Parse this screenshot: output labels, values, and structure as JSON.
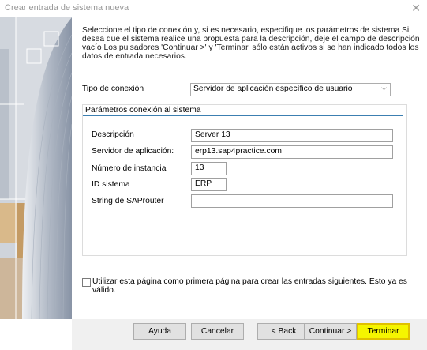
{
  "window": {
    "title": "Crear entrada de sistema nueva"
  },
  "intro": "Seleccione el tipo de conexión y, si es necesario, especifique los parámetros de sistema Si desea que el sistema realice una propuesta para la descripción, deje el campo de descripción vacío Los pulsadores 'Continuar >' y 'Terminar' sólo están activos si se han indicado todos los datos de entrada necesarios.",
  "connection": {
    "label": "Tipo de conexión",
    "value": "Servidor de aplicación específico de usuario"
  },
  "params": {
    "title": "Parámetros conexión al sistema",
    "description": {
      "label": "Descripción",
      "value": "Server 13"
    },
    "app_server": {
      "label": "Servidor de aplicación:",
      "value": "erp13.sap4practice.com"
    },
    "instance": {
      "label": "Número de instancia",
      "value": "13"
    },
    "system_id": {
      "label": "ID sistema",
      "value": "ERP"
    },
    "saprouter": {
      "label": "String de SAProuter",
      "value": ""
    }
  },
  "first_page": {
    "label": "Utilizar esta página como primera página para crear las entradas siguientes. Esto ya es válido.",
    "checked": false
  },
  "buttons": {
    "help": "Ayuda",
    "cancel": "Cancelar",
    "back": "< Back",
    "next": "Continuar >",
    "finish": "Terminar"
  },
  "colors": {
    "finish_highlight": "#f5f500",
    "accent_line": "#3c7fb1"
  }
}
